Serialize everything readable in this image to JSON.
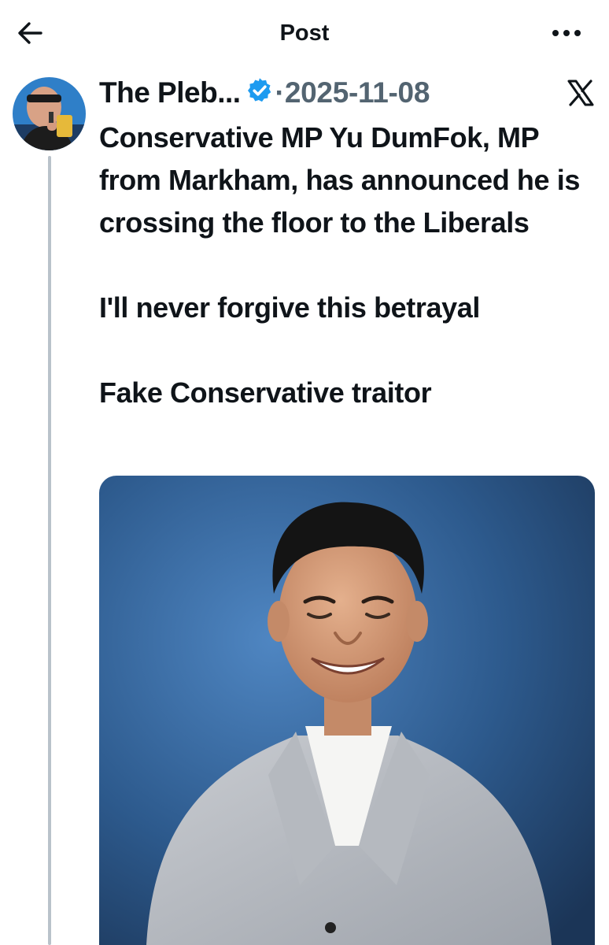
{
  "header": {
    "title": "Post",
    "back_icon": "arrow-left-icon",
    "more_icon": "more-horizontal-icon"
  },
  "post": {
    "display_name": "The Pleb...",
    "verified_icon": "verified-badge-icon",
    "separator": "·",
    "date": "2025-11-08",
    "platform_icon": "x-logo-icon",
    "text_line_1": "Conservative MP Yu DumFok, MP from Markham, has announced he is crossing the floor to the Liberals",
    "text_line_2": "I'll never forgive this betrayal",
    "text_line_3": "Fake Conservative traitor"
  },
  "colors": {
    "text": "#0f1419",
    "muted": "#536471",
    "verified": "#1d9bf0",
    "thread_line": "#b9c2ca",
    "photo_background": "#2f5a8c"
  }
}
